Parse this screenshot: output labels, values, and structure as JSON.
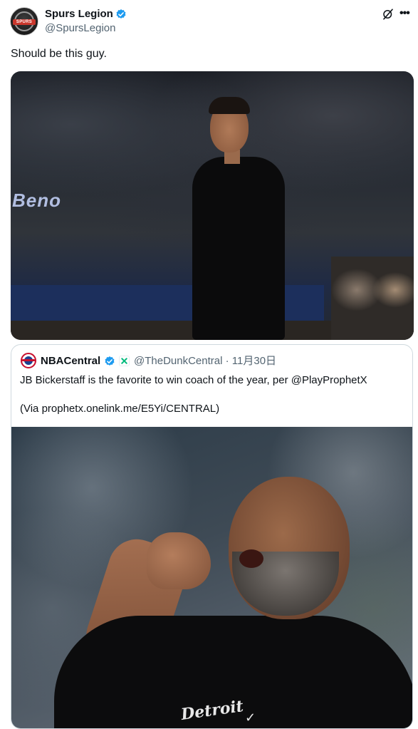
{
  "author": {
    "display_name": "Spurs Legion",
    "handle": "@SpursLegion",
    "avatar_label": "SPURS"
  },
  "tweet": {
    "text": "Should be this guy."
  },
  "quoted": {
    "display_name": "NBACentral",
    "handle_date": "@TheDunkCentral · 11月30日",
    "text_line_1": "JB Bickerstaff is the favorite to win coach of the year, per @PlayProphetX",
    "text_line_2": "(Via prophetx.onelink.me/E5Yi/CENTRAL)"
  },
  "photos": {
    "arena_sign": "Beno",
    "jersey_script": "Detroit"
  },
  "icons": {
    "verified": "verified-badge-icon",
    "grok": "grok-icon",
    "more": "more-options-icon",
    "affiliate": "affiliate-badge-icon"
  },
  "colors": {
    "verified_blue": "#1d9bf0",
    "secondary_text": "#536471",
    "border": "#cfd9de",
    "affiliate_green": "#00ba7c"
  }
}
